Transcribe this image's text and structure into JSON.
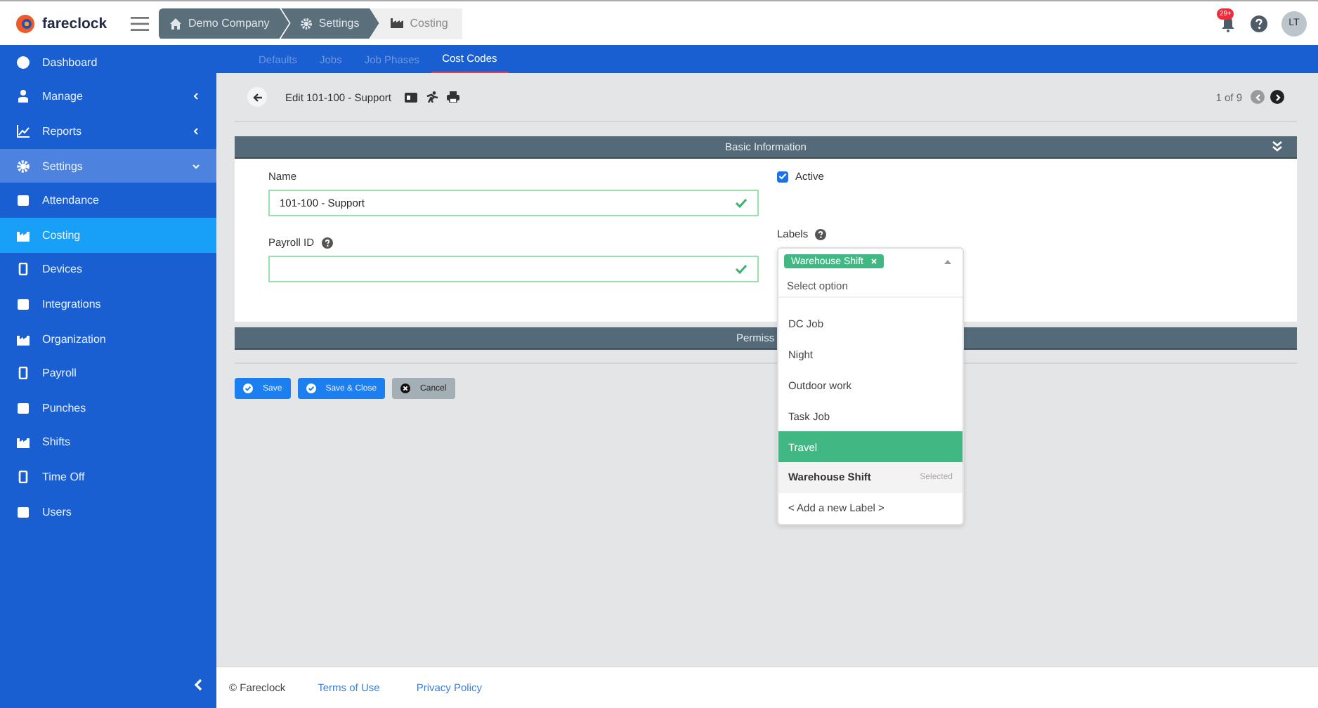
{
  "header": {
    "logo": "fareclock",
    "breadcrumb": [
      {
        "label": "Demo Company",
        "current": false
      },
      {
        "label": "Settings",
        "current": false
      },
      {
        "label": "Costing",
        "current": true
      }
    ],
    "notifications": "29+",
    "avatar": "LT"
  },
  "sidebar": {
    "items": [
      {
        "label": "Dashboard",
        "kind": "link",
        "selected": false
      },
      {
        "label": "Manage",
        "kind": "group",
        "expanded": false
      },
      {
        "label": "Reports",
        "kind": "group",
        "expanded": false
      },
      {
        "label": "Settings",
        "kind": "group",
        "expanded": true,
        "children": [
          {
            "label": "Attendance",
            "selected": false
          },
          {
            "label": "Costing",
            "selected": true
          },
          {
            "label": "Devices",
            "selected": false
          },
          {
            "label": "Integrations",
            "selected": false
          },
          {
            "label": "Organization",
            "selected": false
          },
          {
            "label": "Payroll",
            "selected": false
          },
          {
            "label": "Punches",
            "selected": false
          },
          {
            "label": "Shifts",
            "selected": false
          },
          {
            "label": "Time Off",
            "selected": false
          },
          {
            "label": "Users",
            "selected": false
          }
        ]
      }
    ]
  },
  "tabs": [
    {
      "label": "Defaults",
      "selected": false
    },
    {
      "label": "Jobs",
      "selected": false
    },
    {
      "label": "Job Phases",
      "selected": false
    },
    {
      "label": "Cost Codes",
      "selected": true
    }
  ],
  "toolbar": {
    "title": "Edit 101-100 - Support",
    "pager": "1 of 9",
    "prev": {
      "disabled": true
    },
    "next": {
      "disabled": false
    }
  },
  "basic_panel": {
    "title": "Basic Information",
    "name": {
      "label": "Name",
      "value": "101-100 - Support",
      "valid": true
    },
    "payroll_id": {
      "label": "Payroll ID",
      "valid": true
    },
    "active": {
      "label": "Active",
      "checked": true
    },
    "labels": {
      "label": "Labels",
      "tags": [
        "Warehouse Shift"
      ],
      "placeholder": "Select option",
      "options": [
        {
          "label": "DC Job",
          "highlighted": false,
          "selected": false
        },
        {
          "label": "Night",
          "highlighted": false,
          "selected": false
        },
        {
          "label": "Outdoor work",
          "highlighted": false,
          "selected": false
        },
        {
          "label": "Task Job",
          "highlighted": false,
          "selected": false
        },
        {
          "label": "Travel",
          "highlighted": true,
          "selected": false
        },
        {
          "label": "Warehouse Shift",
          "highlighted": false,
          "selected": true,
          "hint": "Selected"
        }
      ],
      "add_option": "< Add a new Label >"
    }
  },
  "permissions_panel": {
    "title": "Permiss"
  },
  "buttons": [
    {
      "label": "Save",
      "kind": "primary"
    },
    {
      "label": "Save & Close",
      "kind": "primary"
    },
    {
      "label": "Cancel",
      "kind": "secondary"
    }
  ],
  "footer": {
    "copyright": "© Fareclock",
    "links": [
      "Terms of Use",
      "Privacy Policy"
    ]
  }
}
